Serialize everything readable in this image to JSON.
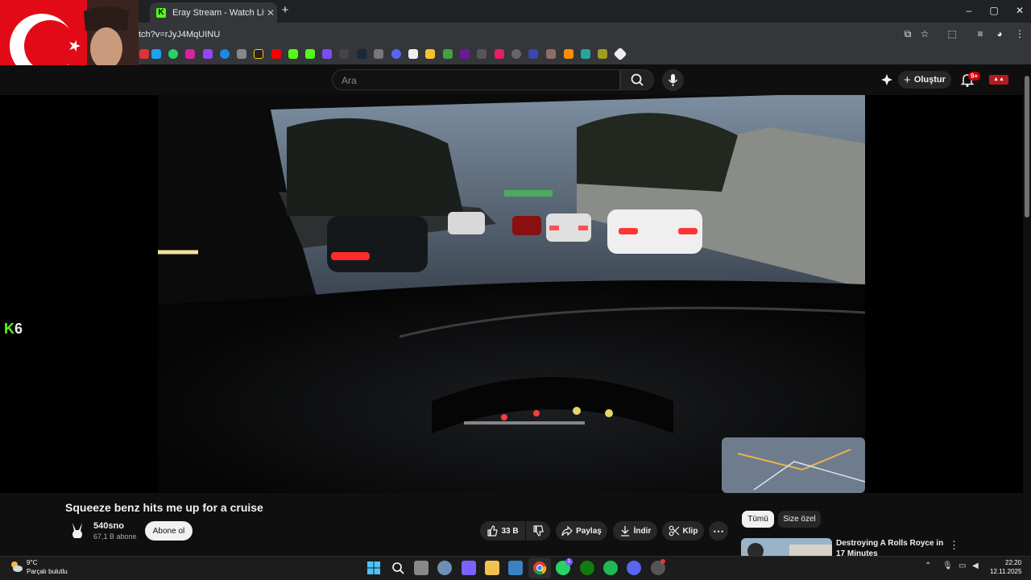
{
  "browser": {
    "tab_title": "Eray Stream - Watch Live on Kick",
    "tab_favicon": "K",
    "new_tab": "+",
    "url": "tch?v=rJyJ4MqUINU",
    "window_controls": [
      "–",
      "▢",
      "✕"
    ]
  },
  "youtube": {
    "search_placeholder": "Ara",
    "create_label": "Oluştur",
    "notifications_badge": "9+",
    "video": {
      "title": "Squeeze benz hits me up for a cruise",
      "channel": "540sno",
      "subscribers": "67,1 B abone",
      "subscribe_label": "Abone ol",
      "likes": "33 B",
      "share_label": "Paylaş",
      "download_label": "İndir",
      "clip_label": "Klip"
    },
    "overlay_text": "6",
    "filters": [
      "Tümü",
      "Size özel"
    ],
    "recommendation": {
      "title": "Destroying A Rolls Royce in 17 Minutes"
    }
  },
  "taskbar": {
    "weather_temp": "9°C",
    "weather_desc": "Parçalı bulutlu",
    "time": "22:20",
    "date": "12.11.2025",
    "whatsapp_badge": "1"
  }
}
